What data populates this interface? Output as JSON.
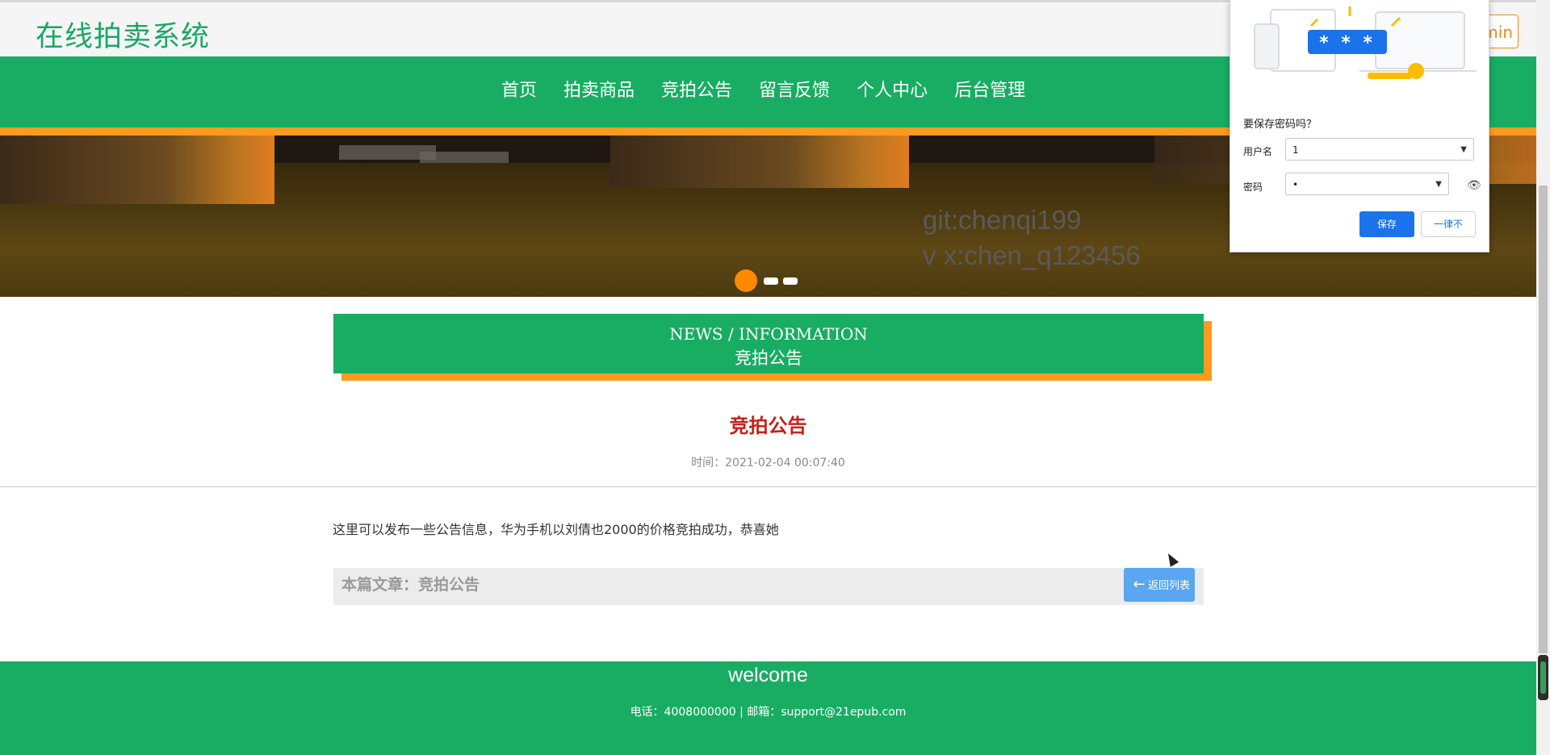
{
  "header": {
    "site_title": "在线拍卖系统",
    "login_label": "min"
  },
  "nav": {
    "items": [
      {
        "label": "首页"
      },
      {
        "label": "拍卖商品"
      },
      {
        "label": "竞拍公告"
      },
      {
        "label": "留言反馈"
      },
      {
        "label": "个人中心"
      },
      {
        "label": "后台管理"
      }
    ]
  },
  "banner": {
    "watermark_line1": "git:chenqi199",
    "watermark_line2": "v x:chen_q123456",
    "slides_total": 3,
    "active_slide": 1
  },
  "section": {
    "title_en": "NEWS / INFORMATION",
    "title_cn": "竞拍公告"
  },
  "article": {
    "title": "竞拍公告",
    "time": "时间：2021-02-04 00:07:40",
    "body": "这里可以发布一些公告信息，华为手机以刘倩也2000的价格竞拍成功，恭喜她",
    "current_label": "本篇文章：竞拍公告",
    "back_label": "返回列表"
  },
  "footer": {
    "welcome": "welcome",
    "contact": "电话：4008000000 | 邮箱：support@21epub.com"
  },
  "password_prompt": {
    "stars": "* * *",
    "question": "要保存密码吗？",
    "username_label": "用户名",
    "username_value": "1",
    "password_label": "密码",
    "password_value": "•",
    "save_label": "保存",
    "never_label": "一律不"
  },
  "colors": {
    "brand_green": "#18ad63",
    "accent_orange": "#ff9a1f",
    "title_red": "#c8201a",
    "chrome_blue": "#1a73e8"
  }
}
